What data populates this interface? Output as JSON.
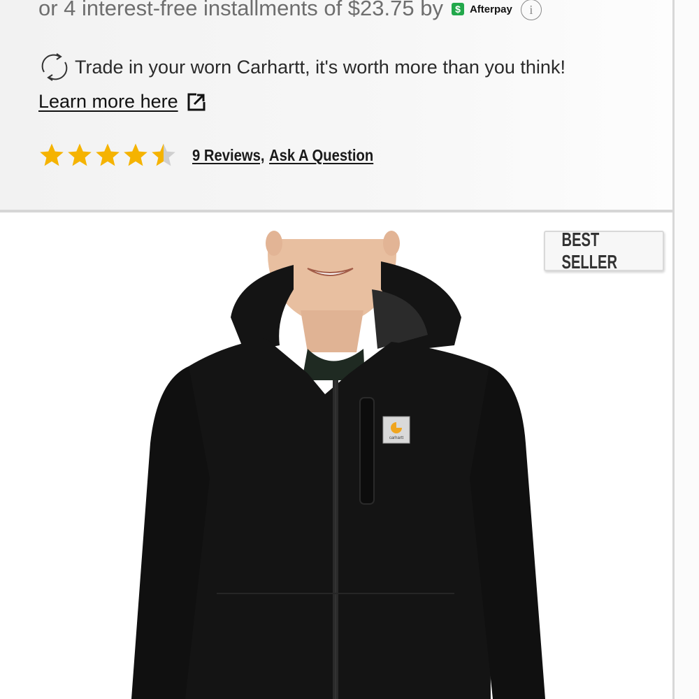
{
  "payment": {
    "installments_text": "or 4 interest-free installments of $23.75 by",
    "provider_symbol": "$",
    "provider_name": "Afterpay",
    "info_symbol": "i"
  },
  "trade_in": {
    "text": "Trade in your worn Carhartt, it's worth more than you think!",
    "link_text": "Learn more here"
  },
  "rating": {
    "stars": 4.5,
    "max_stars": 5,
    "star_color": "#f5b301",
    "reviews_text": "9 Reviews,",
    "ask_text": "Ask A Question"
  },
  "product": {
    "badge_text": "BEST SELLER",
    "label_text": "carhartt",
    "jacket_color": "#141414"
  }
}
